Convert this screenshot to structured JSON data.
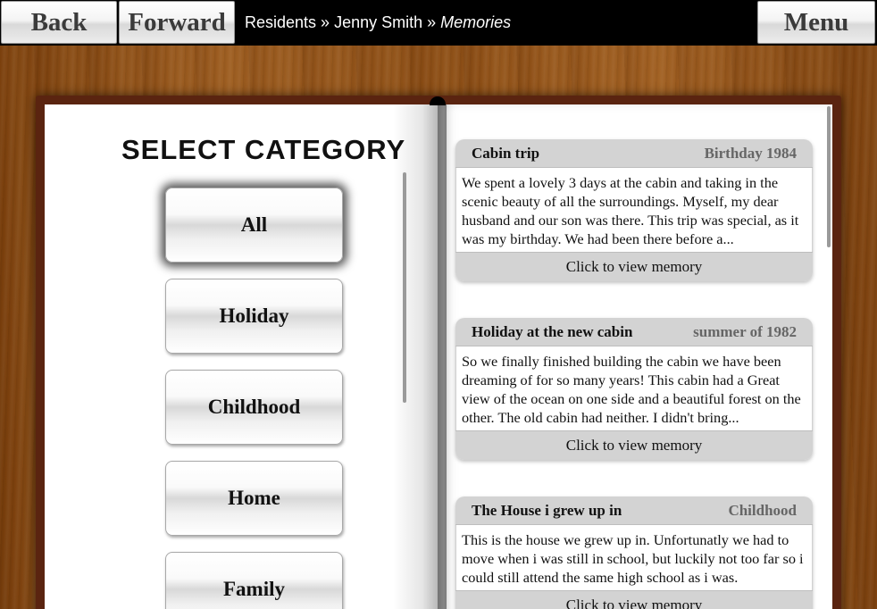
{
  "nav": {
    "back_label": "Back",
    "forward_label": "Forward",
    "menu_label": "Menu"
  },
  "breadcrumb": {
    "items": [
      "Residents",
      "Jenny Smith"
    ],
    "separator": "»",
    "current": "Memories"
  },
  "categories": {
    "title": "SELECT CATEGORY",
    "items": [
      {
        "label": "All",
        "selected": true
      },
      {
        "label": "Holiday",
        "selected": false
      },
      {
        "label": "Childhood",
        "selected": false
      },
      {
        "label": "Home",
        "selected": false
      },
      {
        "label": "Family",
        "selected": false
      }
    ]
  },
  "memories": [
    {
      "title": "Cabin trip",
      "tag": "Birthday 1984",
      "excerpt": "We spent a lovely 3 days at the cabin and taking in the scenic beauty of all the surroundings. Myself, my dear husband and our son was there. This trip was special, as it was my birthday. We had been there before a...",
      "action": "Click to view memory"
    },
    {
      "title": "Holiday at the new cabin",
      "tag": "summer of 1982",
      "excerpt": "So we finally finished building the cabin we have been dreaming of for so many years! This cabin had a Great view of the ocean on one side and a beautiful forest on the other. The old cabin had neither. I didn't bring...",
      "action": "Click to view memory"
    },
    {
      "title": "The House i grew up in",
      "tag": "Childhood",
      "excerpt": "This is the house we grew up in. Unfortunatly we had to move when i was still in school, but luckily not too far so i could still attend the same high school as i was.",
      "action": "Click to view memory"
    }
  ],
  "colors": {
    "topbar": "#000000",
    "book_cover": "#5a2410",
    "card_header": "#d3d3d3",
    "wood": "#8a4c14"
  }
}
